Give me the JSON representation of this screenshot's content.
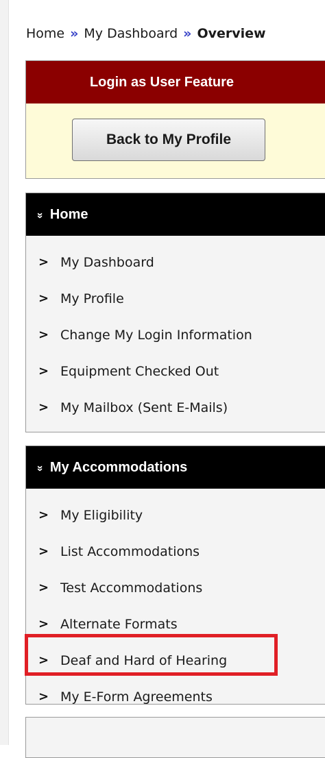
{
  "breadcrumb": {
    "items": [
      "Home",
      "My Dashboard",
      "Overview"
    ],
    "separator": "»"
  },
  "login_feature": {
    "title": "Login as User Feature",
    "button_label": "Back to My Profile"
  },
  "home_menu": {
    "header_icon": "»",
    "title": "Home",
    "chevron": ">",
    "items": [
      "My Dashboard",
      "My Profile",
      "Change My Login Information",
      "Equipment Checked Out",
      "My Mailbox (Sent E-Mails)"
    ]
  },
  "accommodations_menu": {
    "header_icon": "»",
    "title": "My Accommodations",
    "chevron": ">",
    "items": [
      "My Eligibility",
      "List Accommodations",
      "Test Accommodations",
      "Alternate Formats",
      "Deaf and Hard of Hearing",
      "My E-Form Agreements"
    ],
    "highlighted_item": "Deaf and Hard of Hearing"
  },
  "colors": {
    "login_header_bg": "#8b0000",
    "login_panel_bg": "#fefbd8",
    "menu_header_bg": "#000000",
    "highlight": "#e01f26",
    "breadcrumb_separator": "#3a45c8"
  }
}
